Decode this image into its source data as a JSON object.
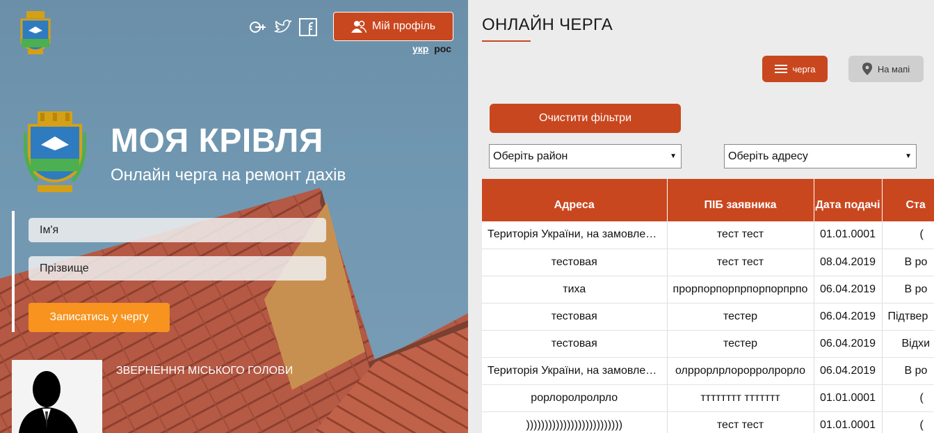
{
  "header": {
    "social": [
      "google-plus-icon",
      "twitter-icon",
      "facebook-icon"
    ],
    "profile_label": "Мій профіль",
    "lang_ukr": "укр",
    "lang_ros": "рос"
  },
  "hero": {
    "title": "МОЯ КРІВЛЯ",
    "subtitle": "Онлайн черга на ремонт дахів"
  },
  "form": {
    "first_name_placeholder": "Ім'я",
    "last_name_placeholder": "Прізвище",
    "submit_label": "Записатись у чергу"
  },
  "mayor": {
    "label": "ЗВЕРНЕННЯ МІСЬКОГО ГОЛОВИ"
  },
  "queue": {
    "title": "ОНЛАЙН ЧЕРГА",
    "queue_tab": "черга",
    "map_tab": "На мапі",
    "clear_filters": "Очистити фільтри",
    "district_select": "Оберіть район",
    "address_select": "Оберіть адресу",
    "columns": [
      "Адреса",
      "ПІБ заявника",
      "Дата подачі",
      "Ста"
    ],
    "rows": [
      [
        "Територія України, на замовлення",
        "тест тест",
        "01.01.0001",
        "("
      ],
      [
        "тестовая",
        "тест тест",
        "08.04.2019",
        "В ро"
      ],
      [
        "тиха",
        "прорпорпорпрпорпорпрпо",
        "06.04.2019",
        "В ро"
      ],
      [
        "тестовая",
        "тестер",
        "06.04.2019",
        "Підтвер"
      ],
      [
        "тестовая",
        "тестер",
        "06.04.2019",
        "Відхи"
      ],
      [
        "Територія України, на замовлення",
        "олррорлрлорорролрорло",
        "06.04.2019",
        "В ро"
      ],
      [
        "рорлоролролрло",
        "тттттттт ттттттт",
        "01.01.0001",
        "("
      ],
      [
        "))))))))))))))))))))))))))",
        "тест тест",
        "01.01.0001",
        "("
      ]
    ]
  },
  "colors": {
    "accent": "#c9471f",
    "signup": "#f7931e",
    "sky": "#6b8fa8"
  }
}
